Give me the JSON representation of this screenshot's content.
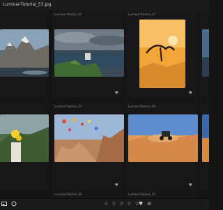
{
  "window": {
    "title": "Luminar-Tutorial_53.jpg"
  },
  "grid": {
    "items": [
      {
        "label": "",
        "row": 1,
        "col": 1
      },
      {
        "label": "Luminar-Tutorial_26",
        "row": 1,
        "col": 2
      },
      {
        "label": "Luminar-Tutorial_47",
        "row": 1,
        "col": 3
      },
      {
        "label": "",
        "row": 1,
        "col": 4
      },
      {
        "label": "",
        "row": 2,
        "col": 1
      },
      {
        "label": "Luminar-Tutorial_13",
        "row": 2,
        "col": 2
      },
      {
        "label": "Luminar-Tutorial_49",
        "row": 2,
        "col": 3
      },
      {
        "label": "",
        "row": 2,
        "col": 4
      },
      {
        "label": "",
        "row": 3,
        "col": 1
      },
      {
        "label": "Luminar-Tutorial_36",
        "row": 3,
        "col": 2
      },
      {
        "label": "Luminar-Tutorial_15",
        "row": 3,
        "col": 3
      }
    ],
    "heart_glyph": "♥"
  },
  "toolbar": {
    "left_icons": [
      "image-icon",
      "circle-icon"
    ],
    "stars": [
      "☆",
      "☆",
      "☆",
      "☆",
      "☆"
    ],
    "favorite_glyph": "♥",
    "reject_glyph": "⊘"
  },
  "colors": {
    "background": "#141416",
    "bar": "#1b1b1e",
    "text": "#d8d8d8"
  }
}
